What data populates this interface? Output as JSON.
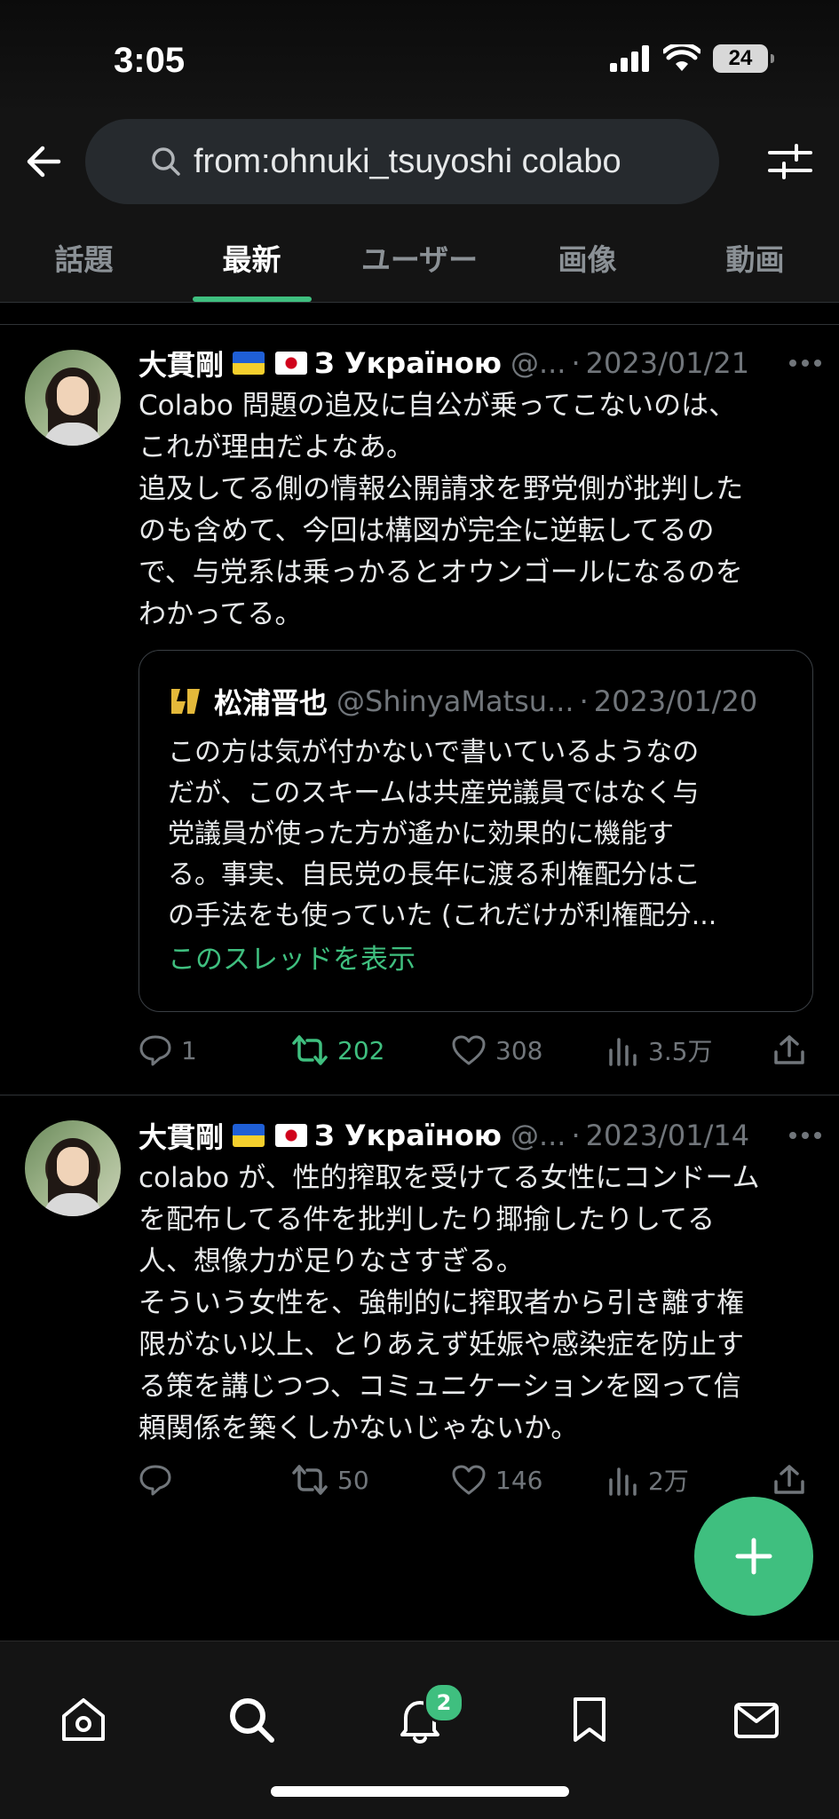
{
  "status_bar": {
    "time": "3:05",
    "battery": "24"
  },
  "search": {
    "query": "from:ohnuki_tsuyoshi colabo"
  },
  "tabs": [
    {
      "label": "話題"
    },
    {
      "label": "最新",
      "active": true
    },
    {
      "label": "ユーザー"
    },
    {
      "label": "画像"
    },
    {
      "label": "動画"
    }
  ],
  "tweets": [
    {
      "author": "大貫剛",
      "author_suffix": "З Україною",
      "handle": "@...",
      "dot": "·",
      "date": "2023/01/21",
      "text": "Colabo 問題の追及に自公が乗ってこないのは、\nこれが理由だよなあ。\n追及してる側の情報公開請求を野党側が批判した\nのも含めて、今回は構図が完全に逆転してるの\nで、与党系は乗っかるとオウンゴールになるのを\nわかってる。",
      "quote": {
        "name": "松浦晋也",
        "handle": "@ShinyaMatsu...",
        "dot": "·",
        "date": "2023/01/20",
        "text": "この方は気が付かないで書いているようなの\nだが、このスキームは共産党議員ではなく与\n党議員が使った方が遙かに効果的に機能す\nる。事実、自民党の長年に渡る利権配分はこ\nの手法をも使っていた (これだけが利権配分...",
        "link": "このスレッドを表示"
      },
      "actions": {
        "replies": "1",
        "retweets": "202",
        "likes": "308",
        "views": "3.5万"
      }
    },
    {
      "author": "大貫剛",
      "author_suffix": "З Україною",
      "handle": "@...",
      "dot": "·",
      "date": "2023/01/14",
      "text": "colabo が、性的搾取を受けてる女性にコンドーム\nを配布してる件を批判したり揶揄したりしてる\n人、想像力が足りなさすぎる。\nそういう女性を、強制的に搾取者から引き離す権\n限がない以上、とりあえず妊娠や感染症を防止す\nる策を講じつつ、コミュニケーションを図って信\n頼関係を築くしかないじゃないか。",
      "actions": {
        "replies": "",
        "retweets": "50",
        "likes": "146",
        "views": "2万"
      }
    }
  ],
  "notifications_badge": "2",
  "colors": {
    "accent": "#3fbf7f",
    "background": "#000000",
    "muted": "#71767b"
  }
}
